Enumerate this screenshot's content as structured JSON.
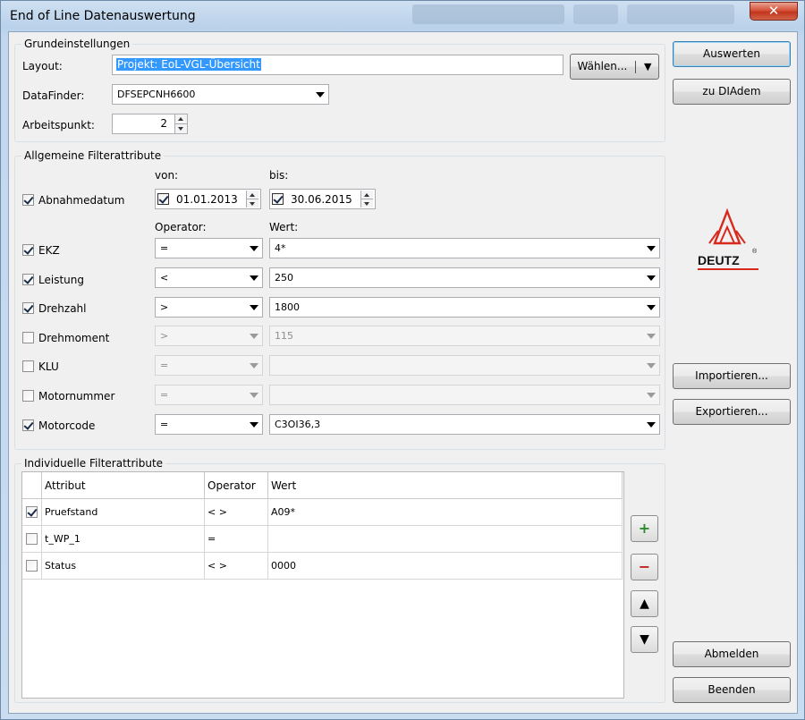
{
  "window": {
    "title": "End of Line Datenauswertung",
    "close": "✕"
  },
  "grund": {
    "title": "Grundeinstellungen",
    "layout_label": "Layout:",
    "layout_value": "Projekt: EoL-VGL-Übersicht",
    "waehlen_label": "Wählen...",
    "datafinder_label": "DataFinder:",
    "datafinder_value": "DFSEPCNH6600",
    "arbeitspunkt_label": "Arbeitspunkt:",
    "arbeitspunkt_value": "2"
  },
  "allg": {
    "title": "Allgemeine Filterattribute",
    "von_label": "von:",
    "bis_label": "bis:",
    "operator_label": "Operator:",
    "wert_label": "Wert:",
    "abnahmedatum": {
      "label": "Abnahmedatum",
      "checked": true,
      "von": "01.01.2013",
      "bis": "30.06.2015"
    },
    "rows": [
      {
        "label": "EKZ",
        "checked": true,
        "operator": "=",
        "wert": "4*",
        "enabled": true
      },
      {
        "label": "Leistung",
        "checked": true,
        "operator": "<",
        "wert": "250",
        "enabled": true
      },
      {
        "label": "Drehzahl",
        "checked": true,
        "operator": ">",
        "wert": "1800",
        "enabled": true
      },
      {
        "label": "Drehmoment",
        "checked": false,
        "operator": ">",
        "wert": "115",
        "enabled": false
      },
      {
        "label": "KLU",
        "checked": false,
        "operator": "=",
        "wert": "",
        "enabled": false
      },
      {
        "label": "Motornummer",
        "checked": false,
        "operator": "=",
        "wert": "",
        "enabled": false
      },
      {
        "label": "Motorcode",
        "checked": true,
        "operator": "=",
        "wert": "C3OI36,3",
        "enabled": true
      }
    ]
  },
  "indiv": {
    "title": "Individuelle Filterattribute",
    "columns": [
      "Attribut",
      "Operator",
      "Wert"
    ],
    "rows": [
      {
        "checked": true,
        "attribut": "Pruefstand",
        "operator": "< >",
        "wert": "A09*"
      },
      {
        "checked": false,
        "attribut": "t_WP_1",
        "operator": "=",
        "wert": ""
      },
      {
        "checked": false,
        "attribut": "Status",
        "operator": "< >",
        "wert": "0000"
      }
    ],
    "add": "+",
    "remove": "−",
    "up": "▲",
    "down": "▼"
  },
  "buttons": {
    "auswerten": "Auswerten",
    "zu_diadem": "zu DIAdem",
    "importieren": "Importieren...",
    "exportieren": "Exportieren...",
    "abmelden": "Abmelden",
    "beenden": "Beenden"
  },
  "logo": {
    "text": "DEUTZ",
    "reg": "®"
  },
  "colors": {
    "logo_red": "#d7291e",
    "add_green": "#2e8b2e",
    "remove_red": "#c0201c"
  }
}
